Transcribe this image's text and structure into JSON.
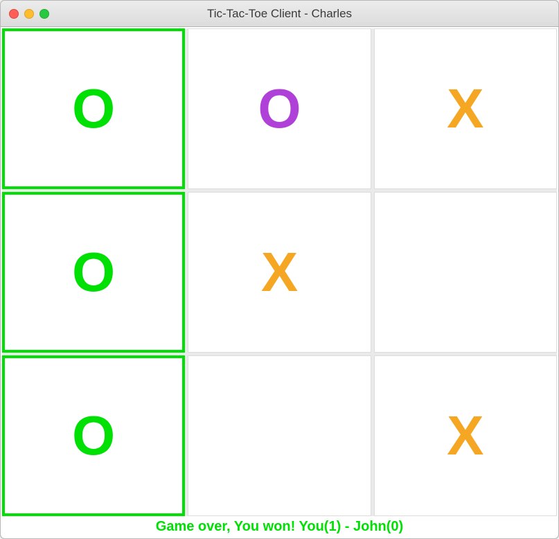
{
  "window": {
    "title": "Tic-Tac-Toe Client - Charles"
  },
  "board": {
    "cells": [
      {
        "mark": "O",
        "colorClass": "mark-o-green",
        "win": true
      },
      {
        "mark": "O",
        "colorClass": "mark-o-purple",
        "win": false
      },
      {
        "mark": "X",
        "colorClass": "mark-x-orange",
        "win": false
      },
      {
        "mark": "O",
        "colorClass": "mark-o-green",
        "win": true
      },
      {
        "mark": "X",
        "colorClass": "mark-x-orange",
        "win": false
      },
      {
        "mark": "",
        "colorClass": "",
        "win": false
      },
      {
        "mark": "O",
        "colorClass": "mark-o-green",
        "win": true
      },
      {
        "mark": "",
        "colorClass": "",
        "win": false
      },
      {
        "mark": "X",
        "colorClass": "mark-x-orange",
        "win": false
      }
    ]
  },
  "status": {
    "message": "Game over, You won! You(1) - John(0)"
  },
  "colors": {
    "win_border": "#00e005",
    "o_green": "#00e005",
    "o_purple": "#b041d8",
    "x_orange": "#f5a623"
  }
}
